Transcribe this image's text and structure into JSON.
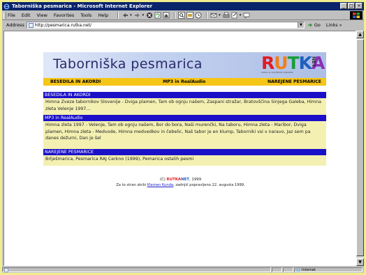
{
  "window": {
    "title": "Taborniška pesmarica - Microsoft Internet Explorer",
    "btn_min": "_",
    "btn_max": "□",
    "btn_close": "×"
  },
  "menu": {
    "file": "File",
    "edit": "Edit",
    "view": "View",
    "favorites": "Favorites",
    "tools": "Tools",
    "help": "Help"
  },
  "address": {
    "label": "Address",
    "url": "http://pesmarica.rutka.net/",
    "go": "Go",
    "links": "Links »"
  },
  "page": {
    "banner_title": "Taborniška pesmarica",
    "logo": {
      "r": "R",
      "u": "U",
      "t": "T",
      "k": "K",
      "a": "A",
      "net": "NET",
      "subtitle": "PORTAL ZA SLOVENSKE TABORNIKE"
    },
    "nav": [
      "BESEDILA IN AKORDI",
      "MP3 in RealAudio",
      "NAREJENE PESMARICE"
    ],
    "sections": [
      {
        "title": "BESEDILA IN AKORDI",
        "body": "Himna Zveze tabornikov Slovenije - Dviga plamen, Tam ob ognju našem, Zaspani stražar, Bratovščina Sinjega Galeba, Himna zleta Velenje 1997..."
      },
      {
        "title": "MP3 in RealAudio",
        "body": "Himna zleta 1997 - Velenje, Tam ob ognju našem, Bor do bora, Naši murenčki, Na taboru, Himna zleta - Maribor, Dviga plamen, Himna zleta - Medvode, Himna medvedkov in čebelic, Naš tabor je en klump, Taborniki vsi v naravo, Jaz sem pa danes dežurni, Dan je šel"
      },
      {
        "title": "NAREJENE PESMARICE",
        "body": "Brlješmarica, Pesmarica RAJ Cerkno (1999), Pemarica ostalih pesmi"
      }
    ],
    "footer": {
      "copy_prefix": "(C)",
      "brand_r": "RUTKA",
      "brand_net": "NET",
      "year": ", 1999",
      "line_prefix": "Za to stran skrbi",
      "author": "Klemen Kunda",
      "line_suffix": ", zadnjič popravljeno 22. avgusta 1999."
    }
  },
  "status": {
    "zone": "Internet"
  }
}
